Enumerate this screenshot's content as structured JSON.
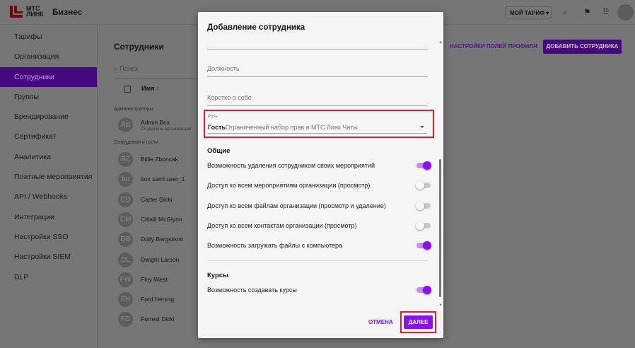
{
  "header": {
    "logo_line1": "МТС",
    "logo_line2": "ЛИНК",
    "brand": "Бизнес",
    "tariff_label": "МОЙ ТАРИФ"
  },
  "sidebar": {
    "items": [
      {
        "label": "Тарифы"
      },
      {
        "label": "Организация"
      },
      {
        "label": "Сотрудники"
      },
      {
        "label": "Группы"
      },
      {
        "label": "Брендирование"
      },
      {
        "label": "Сертификат"
      },
      {
        "label": "Аналитика"
      },
      {
        "label": "Платные мероприятия"
      },
      {
        "label": "API / Webhooks"
      },
      {
        "label": "Интеграции"
      },
      {
        "label": "Настройки SSO"
      },
      {
        "label": "Настройки SIEM"
      },
      {
        "label": "DLP"
      }
    ]
  },
  "main": {
    "title": "Сотрудники",
    "search_placeholder": "Поиск",
    "col_name": "Имя ↑",
    "profile_fields_link": "НАСТРОЙКИ ПОЛЕЙ ПРОФИЛЯ",
    "add_button": "ДОБАВИТЬ СОТРУДНИКА",
    "admins_label": "Администраторы",
    "admin": {
      "initials": "AB",
      "name": "Admin Box",
      "sub": "Создатель организации"
    },
    "staff_label": "Сотрудники и гости",
    "people": [
      {
        "initials": "BZ",
        "name": "Billie Zboncak"
      },
      {
        "initials": "bu",
        "name": "box saml user_1"
      },
      {
        "initials": "CD",
        "name": "Carter Dicki"
      },
      {
        "initials": "CM",
        "name": "Citlalli McGlynn"
      },
      {
        "initials": "DB",
        "name": "Dolly Bergstrom"
      },
      {
        "initials": "DL",
        "name": "Dwight Larson"
      },
      {
        "initials": "FW",
        "name": "Floy West"
      },
      {
        "initials": "FH",
        "name": "Ford Herzog"
      },
      {
        "initials": "FD",
        "name": "Forrest Dicki"
      }
    ]
  },
  "modal": {
    "title": "Добавление сотрудника",
    "position_placeholder": "Должность",
    "about_placeholder": "Коротко о себе",
    "role_label": "Роль",
    "role_value": "Гость",
    "role_desc": "Ограниченный набор прав в МТС Линк Чаты",
    "general_heading": "Общие",
    "general": [
      {
        "label": "Возможность удаления сотрудником своих мероприятий",
        "on": true
      },
      {
        "label": "Доступ ко всем мероприятиям организации (просмотр)",
        "on": false
      },
      {
        "label": "Доступ ко всем файлам организации (просмотр и удаление)",
        "on": false
      },
      {
        "label": "Доступ ко всем контактам организации (просмотр)",
        "on": false
      },
      {
        "label": "Возможность загружать файлы с компьютера",
        "on": true
      }
    ],
    "courses_heading": "Курсы",
    "courses": [
      {
        "label": "Возможность создавать курсы",
        "on": true
      }
    ],
    "cancel": "ОТМЕНА",
    "next": "ДАЛЕЕ"
  }
}
